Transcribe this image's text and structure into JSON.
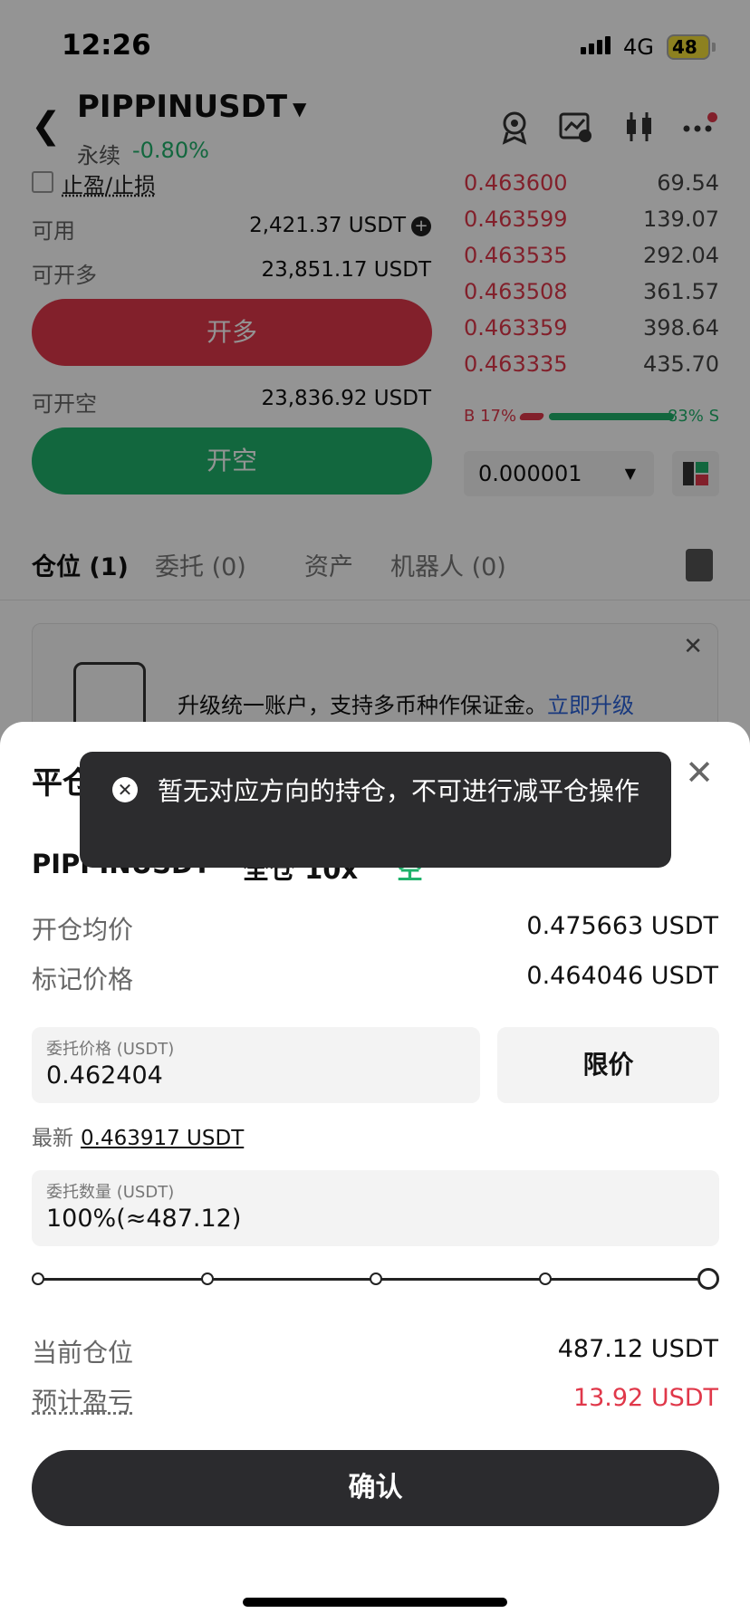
{
  "status_bar": {
    "time": "12:26",
    "network": "4G",
    "battery": "48"
  },
  "header": {
    "symbol": "PIPPINUSDT",
    "contract_type": "永续",
    "change": "-0.80%"
  },
  "order_form": {
    "tp_sl_label": "止盈/止损",
    "available_label": "可用",
    "available_value": "2,421.37 USDT",
    "can_long_label": "可开多",
    "can_long_value": "23,851.17 USDT",
    "long_button": "开多",
    "can_short_label": "可开空",
    "can_short_value": "23,836.92 USDT",
    "short_button": "开空"
  },
  "order_book": {
    "rows": [
      {
        "price": "0.463600",
        "qty": "69.54"
      },
      {
        "price": "0.463599",
        "qty": "139.07"
      },
      {
        "price": "0.463535",
        "qty": "292.04"
      },
      {
        "price": "0.463508",
        "qty": "361.57"
      },
      {
        "price": "0.463359",
        "qty": "398.64"
      },
      {
        "price": "0.463335",
        "qty": "435.70"
      }
    ],
    "buy_ratio": "B 17%",
    "sell_ratio": "83% S",
    "buy_fraction": 0.17,
    "precision": "0.000001"
  },
  "tabs": [
    {
      "label": "仓位 (1)"
    },
    {
      "label": "委托 (0)"
    },
    {
      "label": "资产"
    },
    {
      "label": "机器人 (0)"
    }
  ],
  "banner": {
    "text": "升级统一账户，支持多币种作保证金。",
    "link": "立即升级"
  },
  "sheet": {
    "title": "平仓",
    "symbol": "PIPPINUSDT",
    "margin_leverage": "全仓 10x",
    "side": "空",
    "entry_price_label": "开仓均价",
    "entry_price_value": "0.475663 USDT",
    "mark_price_label": "标记价格",
    "mark_price_value": "0.464046 USDT",
    "order_price_label": "委托价格 (USDT)",
    "order_price_value": "0.462404",
    "order_type": "限价",
    "latest_label": "最新",
    "latest_value": "0.463917 USDT",
    "qty_label": "委托数量 (USDT)",
    "qty_value": "100%(≈487.12)",
    "slider_fraction": 1.0,
    "position_label": "当前仓位",
    "position_value": "487.12 USDT",
    "pnl_label": "预计盈亏",
    "pnl_value": "13.92 USDT",
    "confirm": "确认"
  },
  "toast": {
    "text": "暂无对应方向的持仓，不可进行减平仓操作"
  },
  "colors": {
    "red": "#e0384a",
    "green": "#20b26c",
    "link": "#2b62d9",
    "dark": "#2c2c2e"
  }
}
